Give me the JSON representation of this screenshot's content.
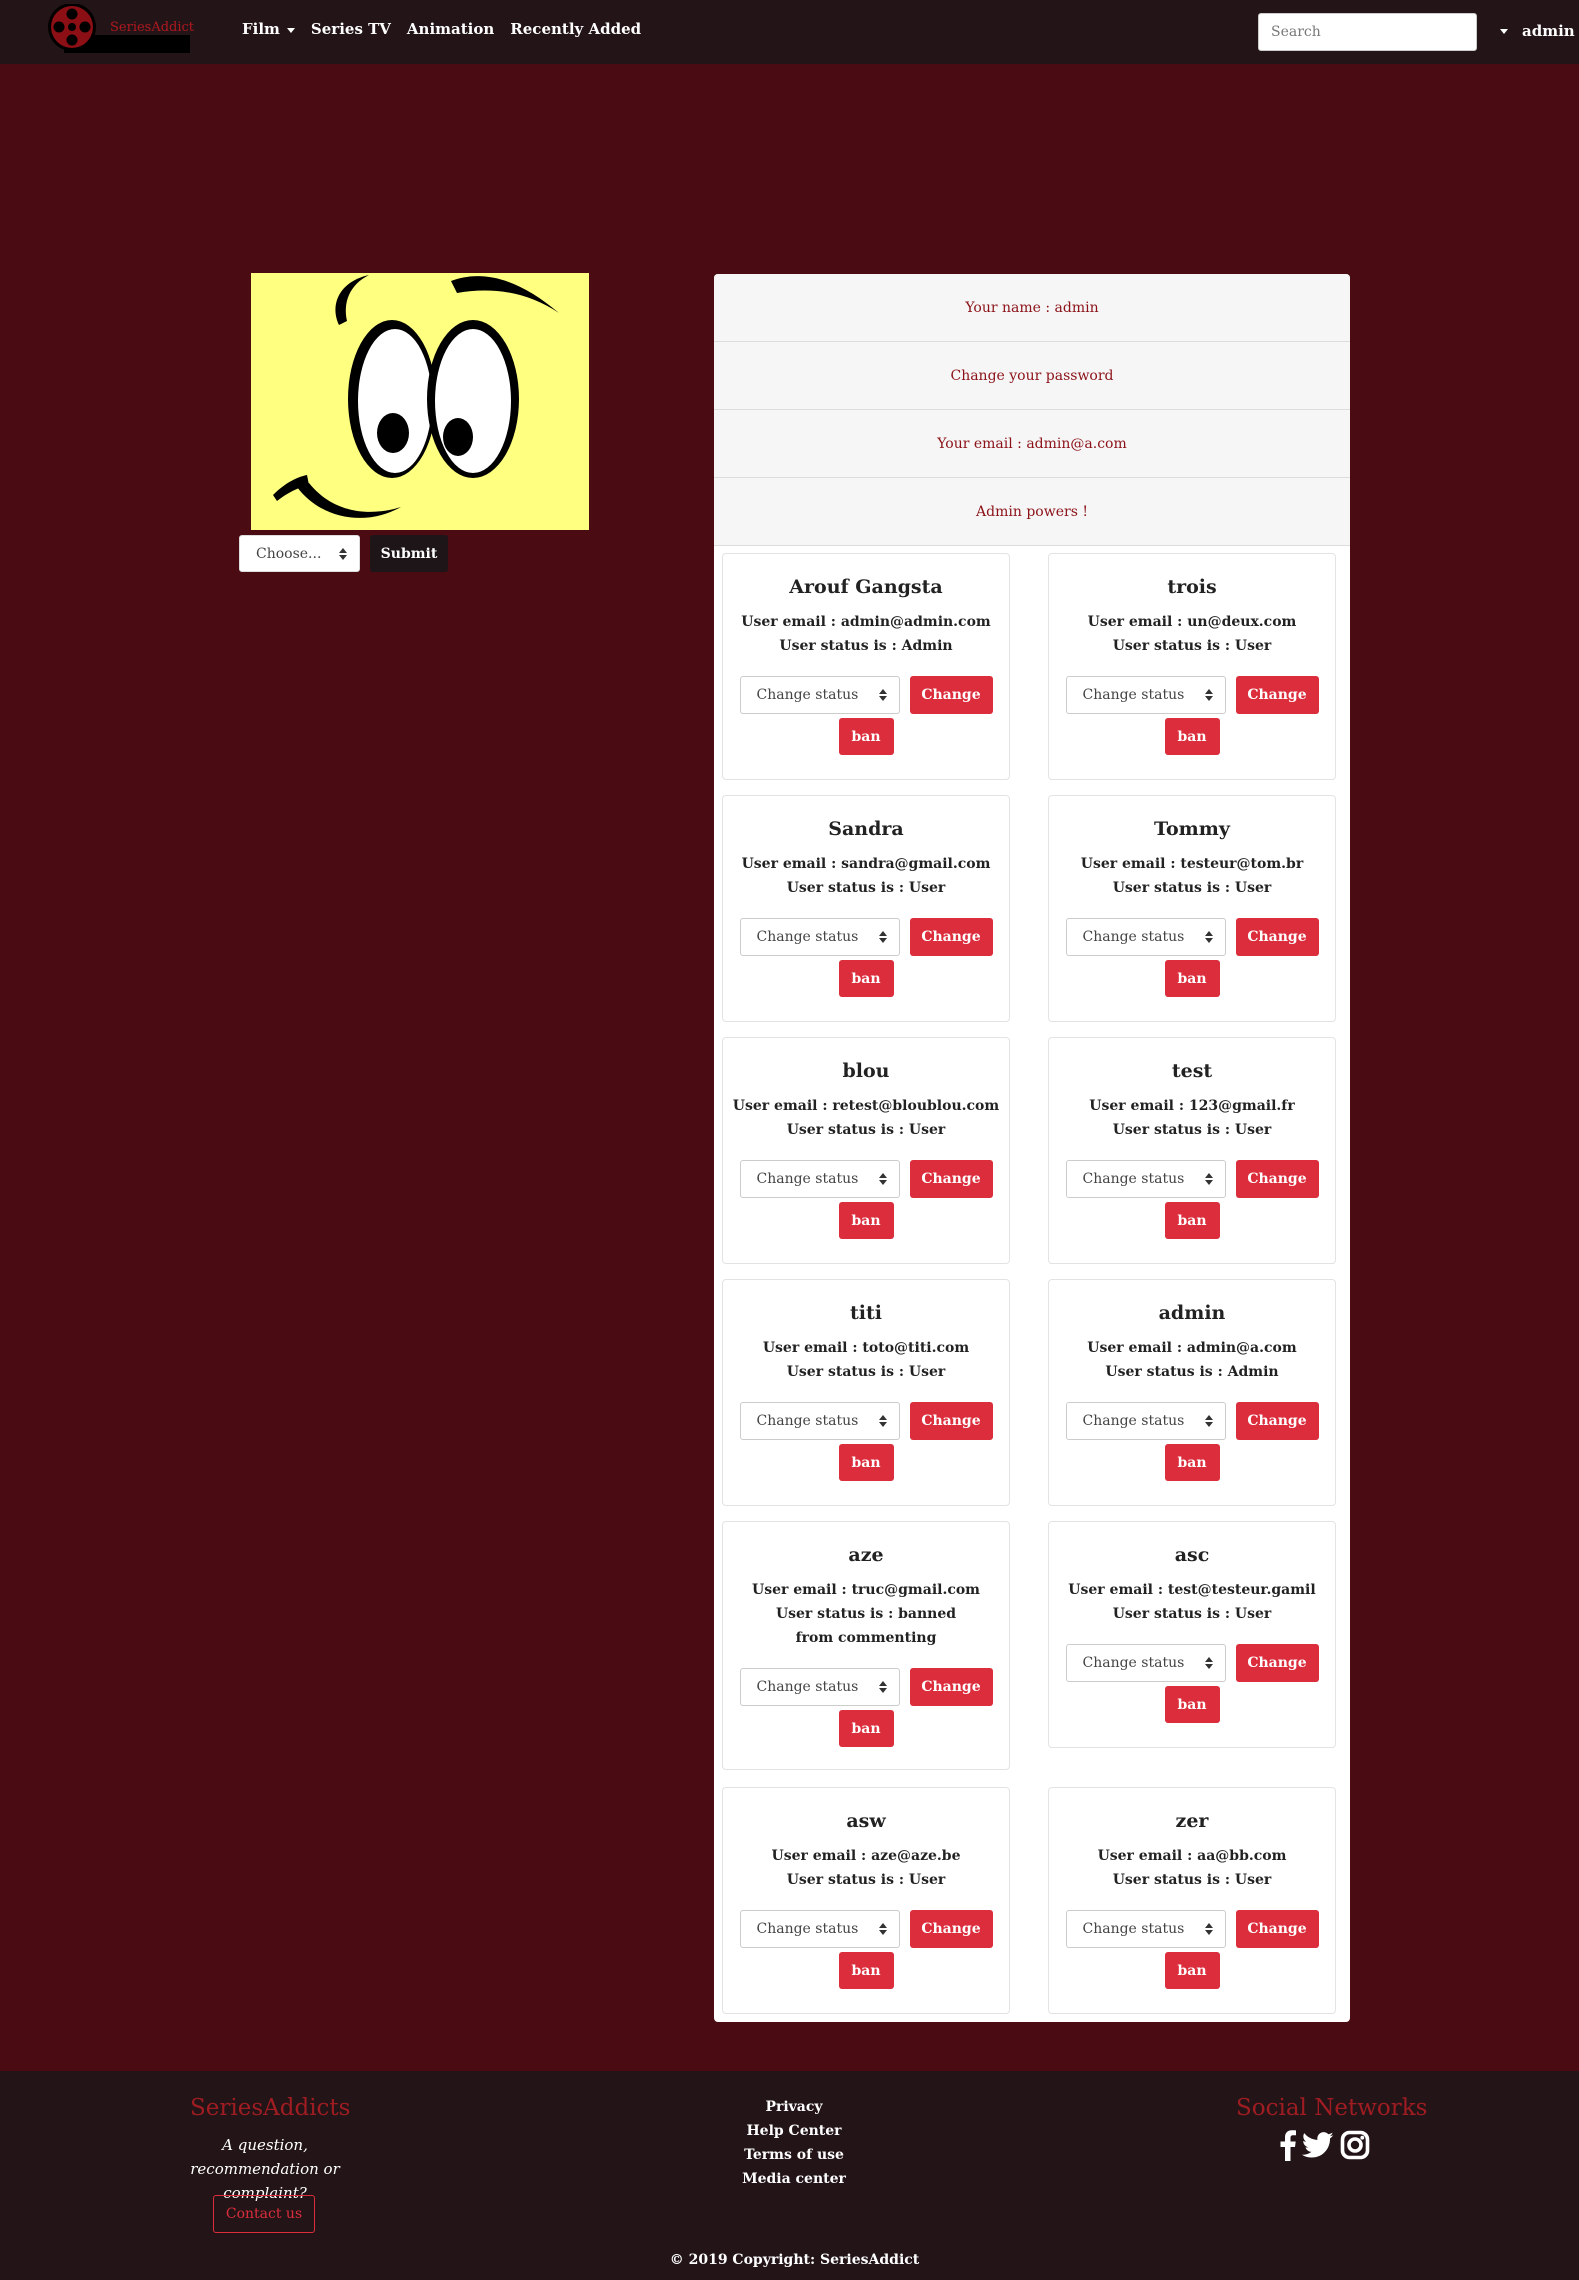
{
  "navbar": {
    "logo_text": "SeriesAddict",
    "links": [
      "Film",
      "Series TV",
      "Animation",
      "Recently Added"
    ],
    "search_placeholder": "Search",
    "user": "admin"
  },
  "avatar": {
    "select_label": "Choose...",
    "submit_label": "Submit"
  },
  "profile": {
    "name_line": "Your name : admin",
    "password_line": "Change your password",
    "email_line": "Your email : admin@a.com",
    "powers_line": "Admin powers !"
  },
  "users": [
    {
      "name": "Arouf Gangsta",
      "email_line": "User email : admin@admin.com",
      "status_line": "User status is : Admin"
    },
    {
      "name": "trois",
      "email_line": "User email : un@deux.com",
      "status_line": "User status is : User"
    },
    {
      "name": "Sandra",
      "email_line": "User email : sandra@gmail.com",
      "status_line": "User status is : User"
    },
    {
      "name": "Tommy",
      "email_line": "User email : testeur@tom.br",
      "status_line": "User status is : User"
    },
    {
      "name": "blou",
      "email_line": "User email : retest@bloublou.com",
      "status_line": "User status is : User"
    },
    {
      "name": "test",
      "email_line": "User email : 123@gmail.fr",
      "status_line": "User status is : User"
    },
    {
      "name": "titi",
      "email_line": "User email : toto@titi.com",
      "status_line": "User status is : User"
    },
    {
      "name": "admin",
      "email_line": "User email : admin@a.com",
      "status_line": "User status is : Admin"
    },
    {
      "name": "aze",
      "email_line": "User email : truc@gmail.com",
      "status_line": "User status is : banned from commenting"
    },
    {
      "name": "asc",
      "email_line": "User email : test@testeur.gamil",
      "status_line": "User status is : User"
    },
    {
      "name": "asw",
      "email_line": "User email : aze@aze.be",
      "status_line": "User status is : User"
    },
    {
      "name": "zer",
      "email_line": "User email : aa@bb.com",
      "status_line": "User status is : User"
    }
  ],
  "user_controls": {
    "select_label": "Change status",
    "change_label": "Change",
    "ban_label": "ban"
  },
  "footer": {
    "brand": "SeriesAddicts",
    "tagline": "A question, recommendation or complaint?",
    "contact_label": "Contact us",
    "links": [
      "Privacy",
      "Help Center",
      "Terms of use",
      "Media center"
    ],
    "social_title": "Social Networks",
    "social_icons": [
      "facebook-icon",
      "twitter-icon",
      "instagram-icon"
    ],
    "copyright": "© 2019 Copyright: SeriesAddict"
  },
  "colors": {
    "page_background": "#4a0b12",
    "navbar": "#231517",
    "accent_red": "#dc2d3c",
    "profile_text": "#8b1218"
  }
}
